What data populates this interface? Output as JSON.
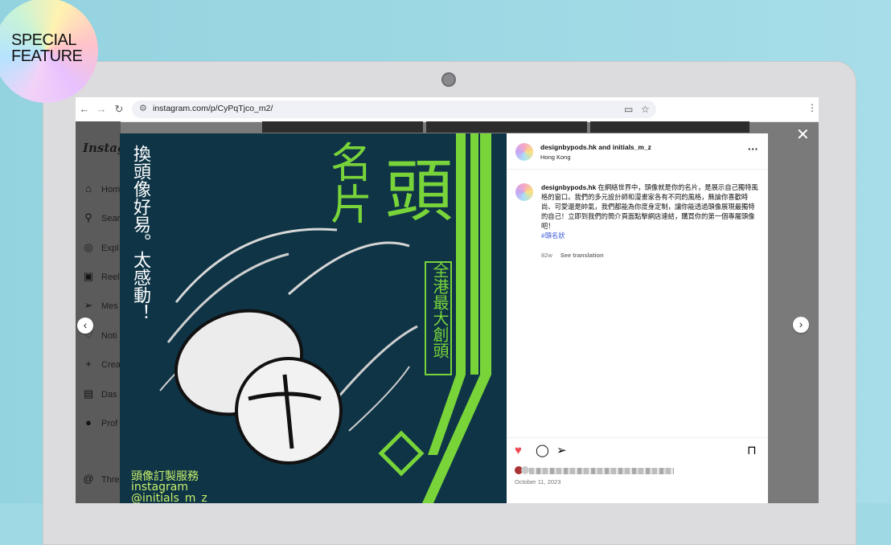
{
  "badge": {
    "line1": "SPECIAL",
    "line2": "FEATURE"
  },
  "browser": {
    "url": "instagram.com/p/CyPqTjco_m2/",
    "nav_icons": [
      "back-arrow-icon",
      "forward-arrow-icon",
      "reload-icon"
    ],
    "right_icons": [
      "cast-icon",
      "bookmark-star-icon",
      "kebab-menu-icon"
    ]
  },
  "instagram_sidebar": {
    "logo": "Instagr",
    "items": [
      {
        "icon": "home-icon",
        "label": "Hom"
      },
      {
        "icon": "search-icon",
        "label": "Sear"
      },
      {
        "icon": "explore-icon",
        "label": "Expl"
      },
      {
        "icon": "reels-icon",
        "label": "Reel"
      },
      {
        "icon": "messages-icon",
        "label": "Mes"
      },
      {
        "icon": "notifications-icon",
        "label": "Noti"
      },
      {
        "icon": "create-icon",
        "label": "Crea"
      },
      {
        "icon": "dashboard-icon",
        "label": "Das"
      },
      {
        "icon": "profile-icon",
        "label": "Prof"
      },
      {
        "icon": "threads-icon",
        "label": "Thre"
      }
    ]
  },
  "artwork": {
    "left_vertical": "換頭像好易。太感動！",
    "title_a": "名片",
    "title_b": "頭",
    "right_vertical": "全港最大創頭",
    "bottom_line1": "頭像訂製服務",
    "bottom_line2": "instagram",
    "bottom_line3": "@initials_m_z",
    "colors": {
      "background": "#0e3446",
      "accent_green": "#79d43a",
      "egg_white": "#f0f0f0"
    }
  },
  "post": {
    "header_user": "designbypods.hk and initials_m_z",
    "location": "Hong Kong",
    "caption_user": "designbypods.hk",
    "caption_text": "在網絡世界中，頭像就是你的名片，是展示自己獨特風格的窗口。我們的多元設計師和漫畫家各有不同的風格，無論你喜歡時尚、可愛還是帥氣，我們都能為你度身定制，讓你能透過頭像展現最獨特的自己！立即到我們的簡介頁面點擊網店連結，購買你的第一個專屬頭像吧！",
    "hashtag": "#頭名狀",
    "age": "82w",
    "see_translation": "See translation",
    "date": "October 11, 2023",
    "action_icons": [
      "heart-icon",
      "comment-icon",
      "share-icon",
      "save-icon"
    ]
  }
}
